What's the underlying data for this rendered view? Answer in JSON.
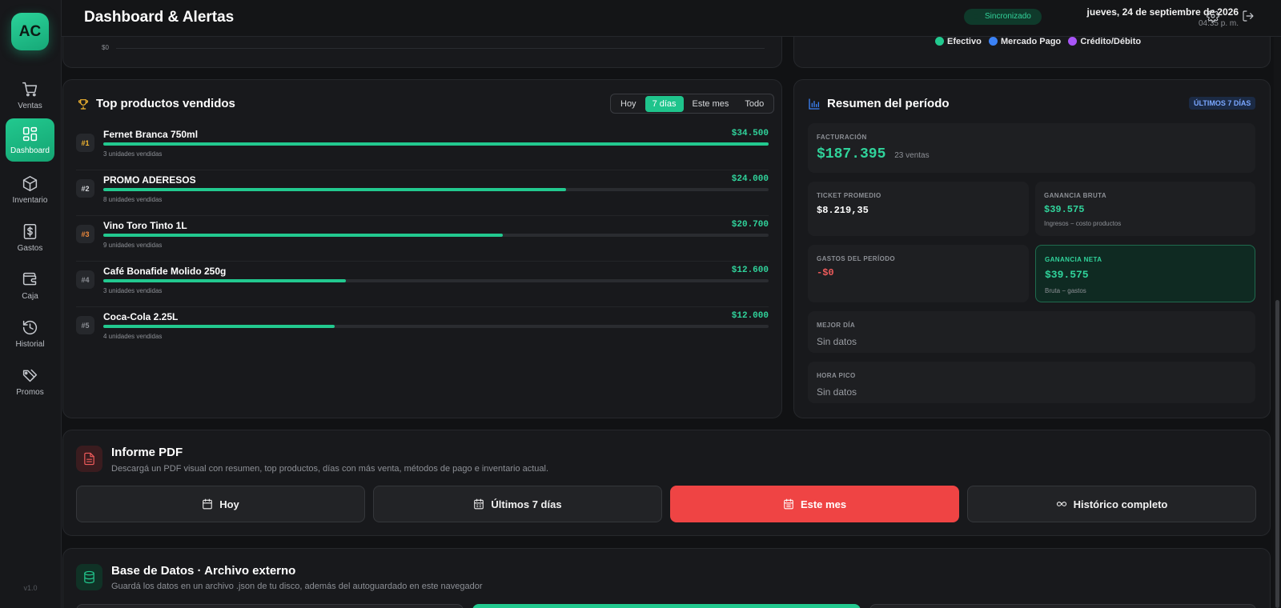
{
  "app": {
    "logo": "AC",
    "version": "v1.0"
  },
  "sidebar": {
    "items": [
      {
        "label": "Ventas",
        "icon": "cart-icon"
      },
      {
        "label": "Dashboard",
        "icon": "grid-icon"
      },
      {
        "label": "Inventario",
        "icon": "box-icon"
      },
      {
        "label": "Gastos",
        "icon": "dollar-icon"
      },
      {
        "label": "Caja",
        "icon": "wallet-icon"
      },
      {
        "label": "Historial",
        "icon": "history-icon"
      },
      {
        "label": "Promos",
        "icon": "tag-icon"
      }
    ]
  },
  "header": {
    "title": "Dashboard & Alertas",
    "sync_status": "Sincronizado",
    "date": "jueves, 24 de septiembre de 2026",
    "time": "04:35 p. m."
  },
  "payments_chart": {
    "axis_label": "$0",
    "legend": [
      {
        "label": "Efectivo",
        "color": "#22c98f"
      },
      {
        "label": "Mercado Pago",
        "color": "#3b82f6"
      },
      {
        "label": "Crédito/Débito",
        "color": "#a855f7"
      }
    ]
  },
  "top_products": {
    "title": "Top productos vendidos",
    "filters": [
      "Hoy",
      "7 días",
      "Este mes",
      "Todo"
    ],
    "active_filter": "7 días",
    "items": [
      {
        "rank": "#1",
        "name": "Fernet Branca 750ml",
        "price": "$34.500",
        "amount": 34500,
        "units": "3 unidades vendidas",
        "rank_color": "#f5b731"
      },
      {
        "rank": "#2",
        "name": "PROMO ADERESOS",
        "price": "$24.000",
        "amount": 24000,
        "units": "8 unidades vendidas",
        "rank_color": "#d5d7db"
      },
      {
        "rank": "#3",
        "name": "Vino Toro Tinto 1L",
        "price": "$20.700",
        "amount": 20700,
        "units": "9 unidades vendidas",
        "rank_color": "#f08a3c"
      },
      {
        "rank": "#4",
        "name": "Café Bonafide Molido 250g",
        "price": "$12.600",
        "amount": 12600,
        "units": "3 unidades vendidas",
        "rank_color": "#8d9096"
      },
      {
        "rank": "#5",
        "name": "Coca-Cola 2.25L",
        "price": "$12.000",
        "amount": 12000,
        "units": "4 unidades vendidas",
        "rank_color": "#8d9096"
      }
    ]
  },
  "summary": {
    "title": "Resumen del período",
    "badge": "ÚLTIMOS 7 DÍAS",
    "facturacion_label": "FACTURACIÓN",
    "facturacion_value": "$187.395",
    "facturacion_sub": "23 ventas",
    "ticket_label": "TICKET PROMEDIO",
    "ticket_value": "$8.219,35",
    "bruta_label": "GANANCIA BRUTA",
    "bruta_value": "$39.575",
    "bruta_sub": "Ingresos − costo productos",
    "gastos_label": "GASTOS DEL PERÍODO",
    "gastos_value": "-$0",
    "neta_label": "GANANCIA NETA",
    "neta_value": "$39.575",
    "neta_sub": "Bruta − gastos",
    "mejor_label": "MEJOR DÍA",
    "mejor_value": "Sin datos",
    "pico_label": "HORA PICO",
    "pico_value": "Sin datos"
  },
  "pdf": {
    "title": "Informe PDF",
    "description": "Descargá un PDF visual con resumen, top productos, días con más venta, métodos de pago e inventario actual.",
    "buttons": [
      "Hoy",
      "Últimos 7 días",
      "Este mes",
      "Histórico completo"
    ]
  },
  "database": {
    "title": "Base de Datos · Archivo externo",
    "description": "Guardá los datos en un archivo .json de tu disco, además del autoguardado en este navegador"
  },
  "colors": {
    "accent": "#22c98f",
    "danger": "#ef4444",
    "info": "#3b82f6"
  }
}
